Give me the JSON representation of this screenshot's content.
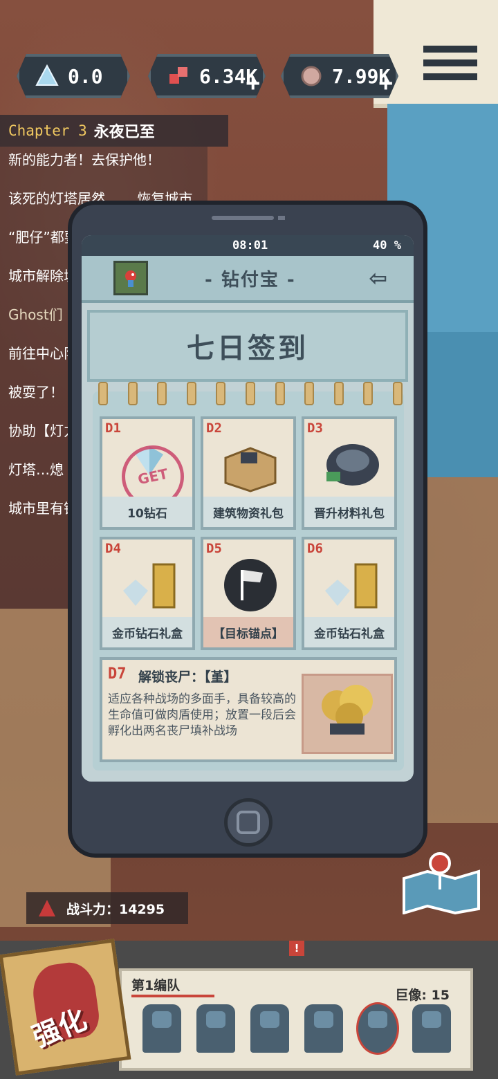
{
  "resources": [
    {
      "icon": "diamond-icon",
      "value": "0.0",
      "has_plus": false
    },
    {
      "icon": "material-icon",
      "value": "6.34K",
      "has_plus": true
    },
    {
      "icon": "coin-icon",
      "value": "7.99K",
      "has_plus": true
    }
  ],
  "chapter": {
    "number_label": "Chapter 3",
    "name": "永夜已至"
  },
  "quests": [
    "新的能力者！去保护他！",
    "该死的灯塔居然…… 恢复城市",
    "“肥仔”都要去哪儿",
    "城市解除城市的限",
    "Ghost们",
    "前往中心队",
    "被耍了！",
    "协助【灯力，拯救",
    "灯塔…熄",
    "城市里有镇"
  ],
  "phone": {
    "time": "08:01",
    "battery": "40 %",
    "app_title": "- 钻付宝 -",
    "back_icon": "back-arrow-icon",
    "banner_title": "七日签到",
    "days": [
      {
        "day": "D1",
        "label": "10钻石",
        "stamp": "GET",
        "art": "diamond-bundle"
      },
      {
        "day": "D2",
        "label": "建筑物资礼包",
        "art": "supply-box"
      },
      {
        "day": "D3",
        "label": "晋升材料礼包",
        "art": "material-pouch"
      },
      {
        "day": "D4",
        "label": "金币钻石礼盒",
        "art": "coins-diamonds"
      },
      {
        "day": "D5",
        "label": "【目标锚点】",
        "art": "target-flag"
      },
      {
        "day": "D6",
        "label": "金币钻石礼盒",
        "art": "coins-diamonds"
      }
    ],
    "day7": {
      "day": "D7",
      "title": "解锁丧尸：【堇】",
      "desc": "适应各种战场的多面手，具备较高的生命值可做肉盾使用；放置一段后会孵化出两名丧尸填补战场"
    }
  },
  "power": {
    "label": "战斗力：14295"
  },
  "upgrade": {
    "label": "强化"
  },
  "team": {
    "name": "第1编队",
    "statue_label": "巨像: 15"
  },
  "notification_badge": "!",
  "colors": {
    "accent_red": "#c9453a",
    "phone_body": "#3a4250",
    "screen_bg": "#c2d2d5"
  }
}
